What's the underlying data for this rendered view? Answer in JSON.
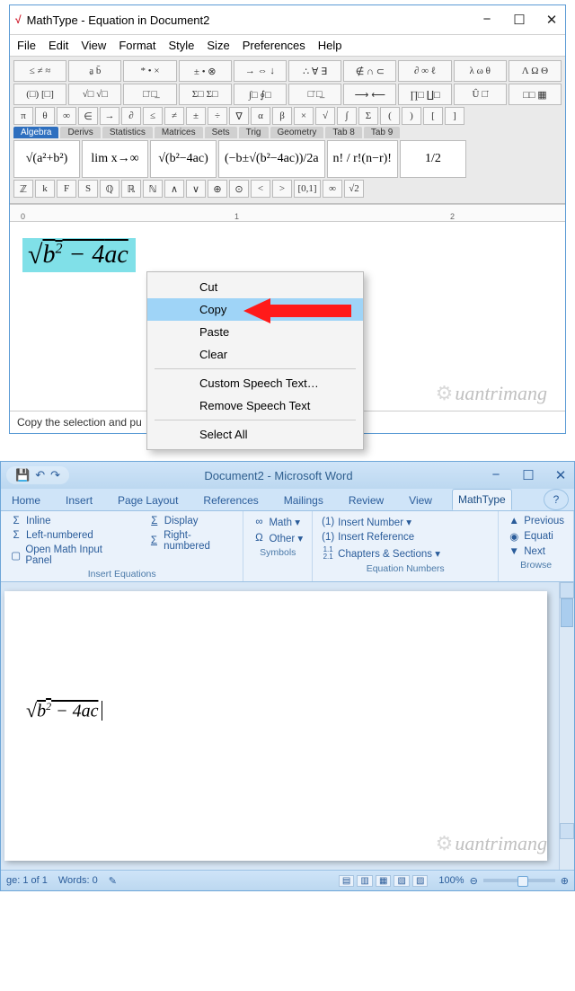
{
  "mathtype": {
    "title": "MathType - Equation in Document2",
    "menubar": [
      "File",
      "Edit",
      "View",
      "Format",
      "Style",
      "Size",
      "Preferences",
      "Help"
    ],
    "toolrows": [
      [
        "≤ ≠ ≈",
        "a̱ b̄",
        "* • ×",
        "± • ⊗",
        "→ ⇔ ↓",
        "∴ ∀ ∃",
        "∉ ∩ ⊂",
        "∂ ∞ ℓ",
        "λ ω θ",
        "Λ Ω Θ"
      ],
      [
        "(□) [□]",
        "√□ √□",
        "□̄ □̲",
        "Σ□ Σ□",
        "∫□ ∮□",
        "□̄ □̲",
        "⟶ ⟵",
        "∏□ ∐□",
        "Û □̇",
        "□□ ▦"
      ],
      [
        "π",
        "θ",
        "∞",
        "∈",
        "→",
        "∂",
        "≤",
        "≠",
        "±",
        "÷",
        "∇",
        "α",
        "β",
        "×",
        "√",
        "∫",
        "Σ",
        "(",
        ")",
        "[",
        "]"
      ]
    ],
    "tabs": [
      "Algebra",
      "Derivs",
      "Statistics",
      "Matrices",
      "Sets",
      "Trig",
      "Geometry",
      "Tab 8",
      "Tab 9"
    ],
    "activeTab": 0,
    "favorites": [
      "√(a²+b²)",
      "lim x→∞",
      "√(b²−4ac)",
      "(−b±√(b²−4ac))/2a",
      "n! / r!(n−r)!",
      "1/2"
    ],
    "symrow": [
      "ℤ",
      "k",
      "F",
      "S",
      "ℚ",
      "ℝ",
      "ℕ",
      "∧",
      "∨",
      "⊕",
      "⊙",
      "<",
      ">",
      "[0,1]",
      "∞",
      "√2"
    ],
    "rulerMarks": {
      "zero": "0",
      "one": "1",
      "two": "2"
    },
    "equation_parts": {
      "radical": "√",
      "body": "b² − 4ac",
      "b": "b",
      "sq": "2",
      "minus": " − 4",
      "ac": "ac"
    },
    "context": {
      "cut": "Cut",
      "copy": "Copy",
      "paste": "Paste",
      "clear": "Clear",
      "customSpeech": "Custom Speech Text…",
      "removeSpeech": "Remove Speech Text",
      "selectAll": "Select All"
    },
    "status": "Copy the selection and pu",
    "watermark": "uantrimang"
  },
  "word": {
    "title": "Document2 - Microsoft Word",
    "qat": [
      "💾",
      "↶",
      "↷"
    ],
    "tabs": [
      "Home",
      "Insert",
      "Page Layout",
      "References",
      "Mailings",
      "Review",
      "View",
      "MathType"
    ],
    "activeTab": 7,
    "ribbon": {
      "insertEq": {
        "inline": "Inline",
        "left": "Left-numbered",
        "open": "Open Math Input Panel",
        "display": "Display",
        "right": "Right-numbered",
        "label": "Insert Equations",
        "sigma": "Σ",
        "sigmaR": "Σ"
      },
      "symbols": {
        "math": "Math ▾",
        "other": "Other ▾",
        "label": "Symbols",
        "inf": "∞",
        "omega": "Ω"
      },
      "eqnum": {
        "insNum": "Insert Number ▾",
        "insRef": "Insert Reference",
        "chapSec": "Chapters & Sections ▾",
        "label": "Equation Numbers",
        "n1": "(1)",
        "n11": "(1)",
        "n112": "1.1\n2.1"
      },
      "browse": {
        "prev": "Previous",
        "eq": "Equati",
        "next": "Next",
        "label": "Browse"
      }
    },
    "equation": {
      "b": "b",
      "sq": "2",
      "rest": " − 4ac",
      "rad": "√"
    },
    "status": {
      "page": "ge: 1 of 1",
      "words": "Words: 0",
      "zoom": "100%",
      "minus": "⊖",
      "plus": "⊕"
    },
    "watermark": "uantrimang"
  }
}
